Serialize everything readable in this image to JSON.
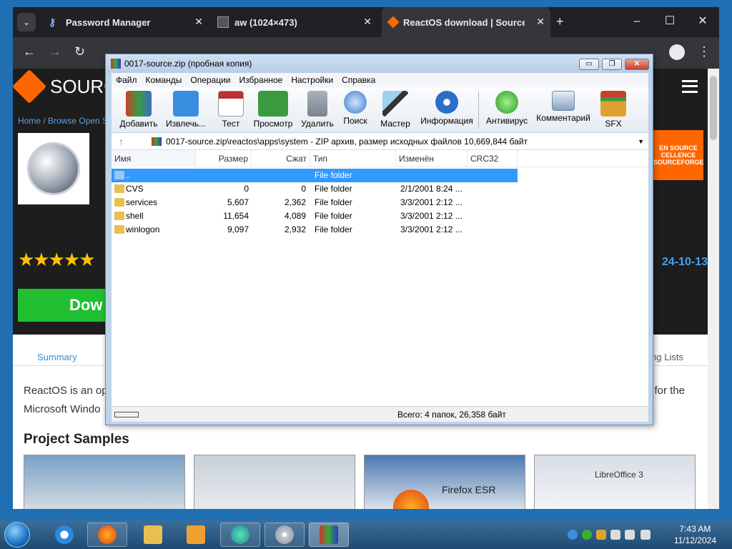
{
  "browser": {
    "tabs": [
      {
        "title": "Password Manager",
        "icon": "key-icon"
      },
      {
        "title": "aw (1024×473)",
        "icon": "image-icon"
      },
      {
        "title": "ReactOS download | SourceFor",
        "icon": "sourceforge-icon"
      }
    ],
    "new_tab": "+",
    "close": "✕"
  },
  "page": {
    "logo_text": "SOURC",
    "breadcrumb": "Home / Browse Open S",
    "download_label": "Dow",
    "badge_text": "EN SOURCE CELLENCE SOURCEFORGE",
    "date": "24-10-13",
    "tab_summary": "Summary",
    "tab_mailing": "ng Lists",
    "desc_line1": "ReactOS is an op",
    "desc_line2": "Microsoft Windo",
    "desc_line3": "for the",
    "samples_title": "Project Samples",
    "thumb_firefox": "Firefox ESR",
    "thumb_libre": "LibreOffice 3"
  },
  "winrar": {
    "title": "0017-source.zip (пробная копия)",
    "menu": [
      "Файл",
      "Команды",
      "Операции",
      "Избранное",
      "Настройки",
      "Справка"
    ],
    "tools": [
      {
        "label": "Добавить",
        "icon": "add-archive-icon",
        "color": "#c8402a"
      },
      {
        "label": "Извлечь...",
        "icon": "extract-folder-icon",
        "color": "#3a8ee0"
      },
      {
        "label": "Тест",
        "icon": "test-clipboard-icon",
        "color": "#c03030"
      },
      {
        "label": "Просмотр",
        "icon": "view-book-icon",
        "color": "#3a9a40"
      },
      {
        "label": "Удалить",
        "icon": "trash-icon",
        "color": "#8a949e"
      },
      {
        "label": "Поиск",
        "icon": "magnifier-icon",
        "color": "#3a78c8"
      },
      {
        "label": "Мастер",
        "icon": "wizard-wand-icon",
        "color": "#9fd0f0"
      },
      {
        "label": "Информация",
        "icon": "info-icon",
        "color": "#2a6ec8"
      },
      {
        "label": "Антивирус",
        "icon": "antivirus-bug-icon",
        "color": "#3ab030"
      },
      {
        "label": "Комментарий",
        "icon": "comment-icon",
        "color": "#6a8ab0"
      },
      {
        "label": "SFX",
        "icon": "sfx-box-icon",
        "color": "#e0a030"
      }
    ],
    "path": "0017-source.zip\\reactos\\apps\\system - ZIP архив, размер исходных файлов 10,669,844 байт",
    "columns": [
      "Имя",
      "Размер",
      "Сжат",
      "Тип",
      "Изменён",
      "CRC32"
    ],
    "rows": [
      {
        "name": "..",
        "size": "",
        "packed": "",
        "type": "File folder",
        "modified": "",
        "crc": ""
      },
      {
        "name": "CVS",
        "size": "0",
        "packed": "0",
        "type": "File folder",
        "modified": "2/1/2001 8:24 ...",
        "crc": ""
      },
      {
        "name": "services",
        "size": "5,607",
        "packed": "2,362",
        "type": "File folder",
        "modified": "3/3/2001 2:12 ...",
        "crc": ""
      },
      {
        "name": "shell",
        "size": "11,654",
        "packed": "4,089",
        "type": "File folder",
        "modified": "3/3/2001 2:12 ...",
        "crc": ""
      },
      {
        "name": "winlogon",
        "size": "9,097",
        "packed": "2,932",
        "type": "File folder",
        "modified": "3/3/2001 2:12 ...",
        "crc": ""
      }
    ],
    "status": "Всего: 4 папок, 26,358 байт"
  },
  "taskbar": {
    "time": "7:43 AM",
    "date": "11/12/2024"
  }
}
